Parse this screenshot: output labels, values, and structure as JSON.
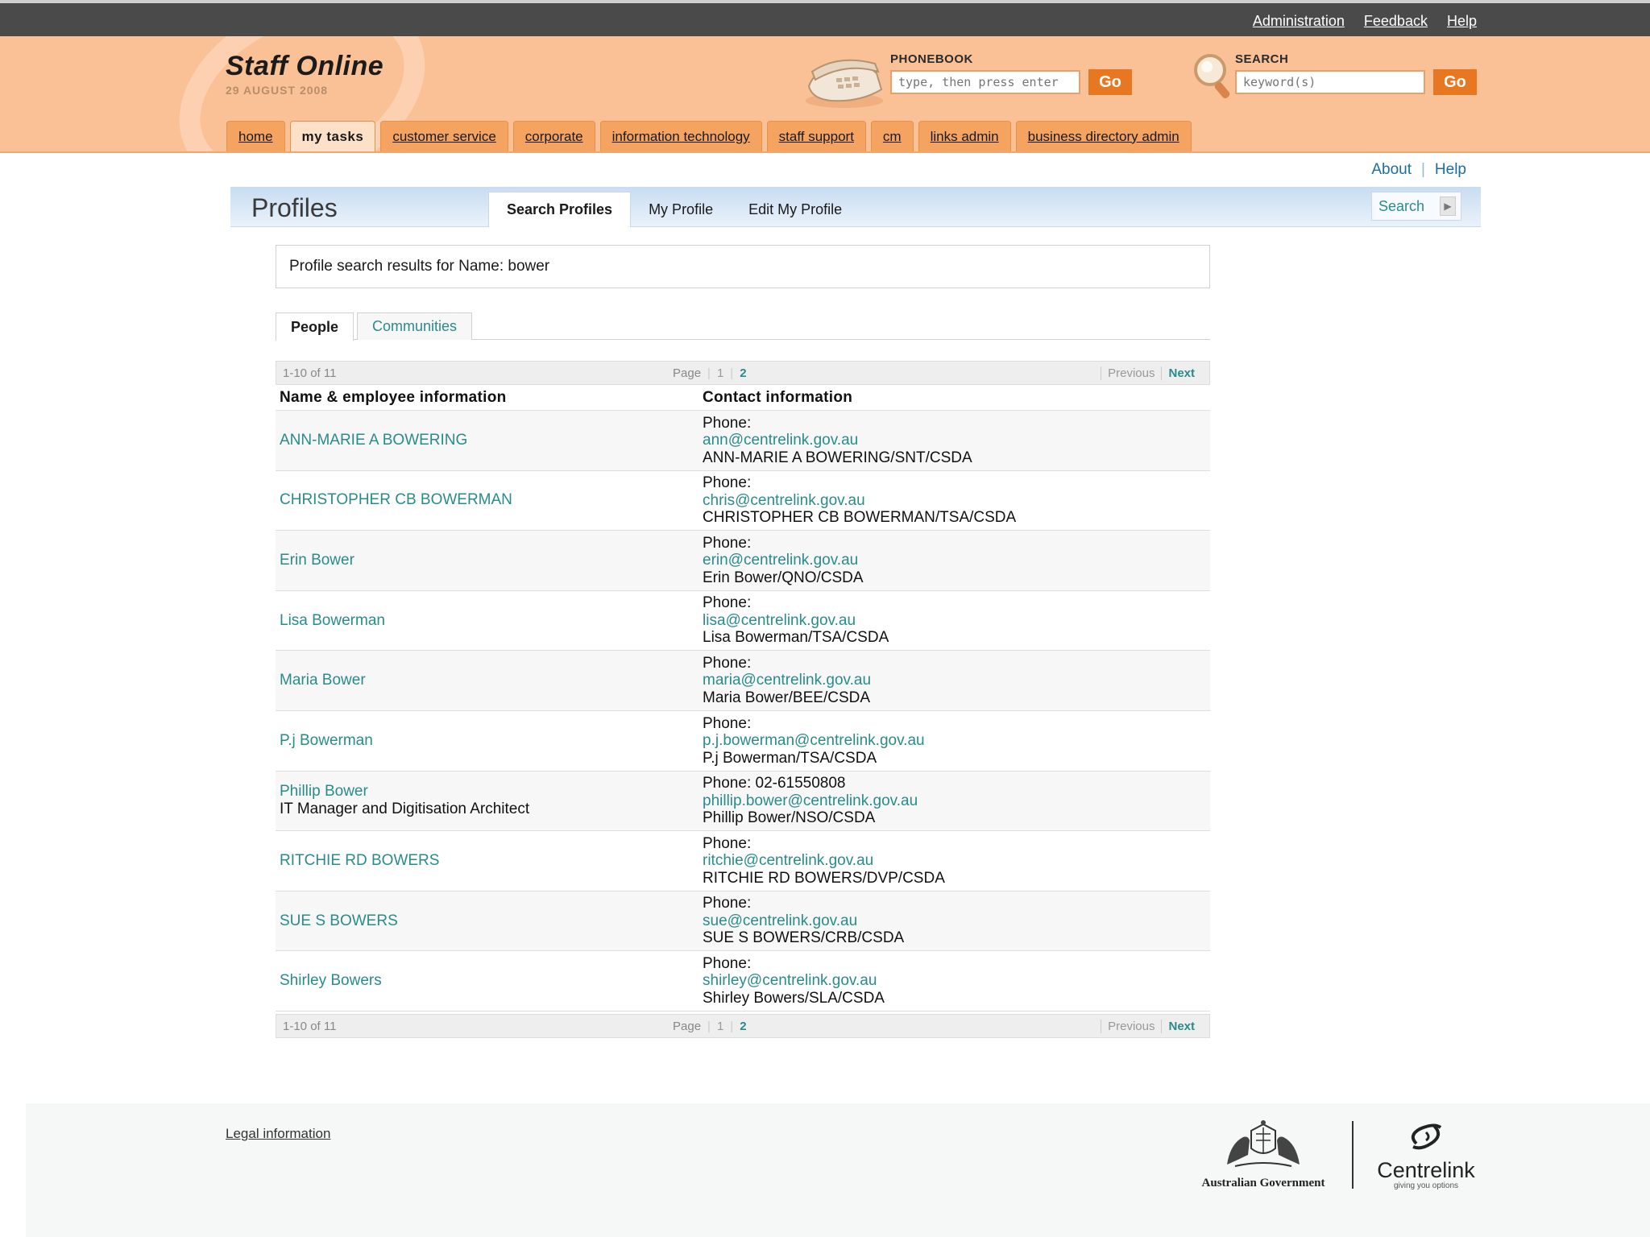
{
  "top_links": [
    "Administration",
    "Feedback",
    "Help"
  ],
  "brand": {
    "title": "Staff Online",
    "date": "29 AUGUST 2008"
  },
  "phonebook": {
    "label": "PHONEBOOK",
    "placeholder": "type, then press enter",
    "go": "Go"
  },
  "search": {
    "label": "SEARCH",
    "placeholder": "keyword(s)",
    "go": "Go"
  },
  "nav_tabs": [
    {
      "label": "home",
      "active": false
    },
    {
      "label": "my tasks",
      "active": true
    },
    {
      "label": "customer service",
      "active": false
    },
    {
      "label": "corporate",
      "active": false
    },
    {
      "label": "information technology",
      "active": false
    },
    {
      "label": "staff support",
      "active": false
    },
    {
      "label": "cm",
      "active": false
    },
    {
      "label": "links admin",
      "active": false
    },
    {
      "label": "business directory admin",
      "active": false
    }
  ],
  "about_help": {
    "about": "About",
    "help": "Help"
  },
  "profiles": {
    "title": "Profiles",
    "tabs": [
      {
        "label": "Search Profiles",
        "active": true
      },
      {
        "label": "My Profile",
        "active": false
      },
      {
        "label": "Edit My Profile",
        "active": false
      }
    ],
    "search_button": "Search"
  },
  "summary": "Profile search results for Name: bower",
  "sub_tabs": [
    {
      "label": "People",
      "active": true
    },
    {
      "label": "Communities",
      "active": false
    }
  ],
  "pager": {
    "count": "1-10 of 11",
    "page_label": "Page",
    "current_page": "1",
    "other_page": "2",
    "previous": "Previous",
    "next": "Next"
  },
  "table": {
    "headers": [
      "Name & employee information",
      "Contact information"
    ],
    "rows": [
      {
        "name": "ANN-MARIE A BOWERING",
        "title": "",
        "phone": "Phone:",
        "email": "ann@centrelink.gov.au",
        "notes": "ANN-MARIE A BOWERING/SNT/CSDA"
      },
      {
        "name": "CHRISTOPHER CB BOWERMAN",
        "title": "",
        "phone": "Phone:",
        "email": "chris@centrelink.gov.au",
        "notes": "CHRISTOPHER CB BOWERMAN/TSA/CSDA"
      },
      {
        "name": "Erin Bower",
        "title": "",
        "phone": "Phone:",
        "email": "erin@centrelink.gov.au",
        "notes": "Erin Bower/QNO/CSDA"
      },
      {
        "name": "Lisa Bowerman",
        "title": "",
        "phone": "Phone:",
        "email": "lisa@centrelink.gov.au",
        "notes": "Lisa Bowerman/TSA/CSDA"
      },
      {
        "name": "Maria Bower",
        "title": "",
        "phone": "Phone:",
        "email": "maria@centrelink.gov.au",
        "notes": "Maria Bower/BEE/CSDA"
      },
      {
        "name": "P.j Bowerman",
        "title": "",
        "phone": "Phone:",
        "email": "p.j.bowerman@centrelink.gov.au",
        "notes": "P.j Bowerman/TSA/CSDA"
      },
      {
        "name": "Phillip Bower",
        "title": "IT Manager and Digitisation Architect",
        "phone": "Phone: 02-61550808",
        "email": "phillip.bower@centrelink.gov.au",
        "notes": "Phillip Bower/NSO/CSDA"
      },
      {
        "name": "RITCHIE RD BOWERS",
        "title": "",
        "phone": "Phone:",
        "email": "ritchie@centrelink.gov.au",
        "notes": "RITCHIE RD BOWERS/DVP/CSDA"
      },
      {
        "name": "SUE S BOWERS",
        "title": "",
        "phone": "Phone:",
        "email": "sue@centrelink.gov.au",
        "notes": "SUE S BOWERS/CRB/CSDA"
      },
      {
        "name": "Shirley Bowers",
        "title": "",
        "phone": "Phone:",
        "email": "shirley@centrelink.gov.au",
        "notes": "Shirley Bowers/SLA/CSDA"
      }
    ]
  },
  "footer": {
    "legal": "Legal information",
    "gov_text": "Australian Government",
    "centrelink": "Centrelink",
    "tagline": "giving you options"
  },
  "icons": {
    "phone": "phone-icon",
    "search": "magnifier-icon",
    "arrow": "arrow-right-icon",
    "crest": "coat-of-arms-icon",
    "swirl": "centrelink-swirl-icon"
  },
  "colors": {
    "header_orange": "#fbc196",
    "tab_orange": "#f4a460",
    "go_orange": "#e87722",
    "link_teal": "#2a8b8b",
    "topbar": "#4a4a4a"
  }
}
